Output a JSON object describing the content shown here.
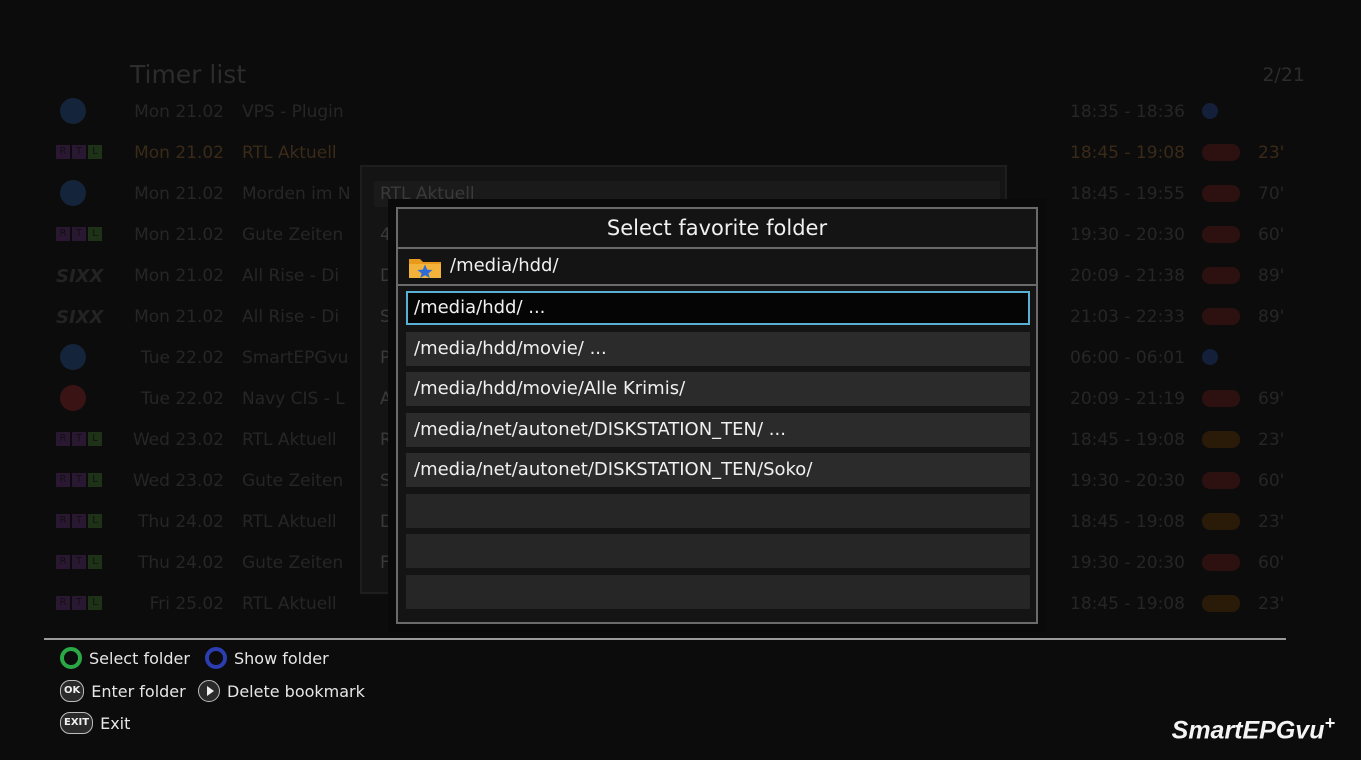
{
  "background": {
    "title": "Timer list",
    "page_indicator": "2/21",
    "timers": [
      {
        "date": "Mon 21.02",
        "name": "VPS - Plugin",
        "time": "18:35 - 18:36",
        "duration": "",
        "status": "blue",
        "logo": "calendar-icon"
      },
      {
        "date": "Mon 21.02",
        "name": "RTL Aktuell",
        "time": "18:45 - 19:08",
        "duration": "23'",
        "status": "red",
        "logo": "rtl-logo"
      },
      {
        "date": "Mon 21.02",
        "name": "Morden im N",
        "time": "18:45 - 19:55",
        "duration": "70'",
        "status": "red",
        "logo": "das-erste-logo"
      },
      {
        "date": "Mon 21.02",
        "name": "Gute Zeiten",
        "time": "19:30 - 20:30",
        "duration": "60'",
        "status": "red",
        "logo": "rtl-logo"
      },
      {
        "date": "Mon 21.02",
        "name": "All Rise - Di",
        "time": "20:09 - 21:38",
        "duration": "89'",
        "status": "red",
        "logo": "sixx-logo"
      },
      {
        "date": "Mon 21.02",
        "name": "All Rise - Di",
        "time": "21:03 - 22:33",
        "duration": "89'",
        "status": "red",
        "logo": "sixx-logo"
      },
      {
        "date": "Tue 22.02",
        "name": "SmartEPGvu",
        "time": "06:00 - 06:01",
        "duration": "",
        "status": "blue",
        "logo": "satellite-icon"
      },
      {
        "date": "Tue 22.02",
        "name": "Navy CIS - L",
        "time": "20:09 - 21:19",
        "duration": "69'",
        "status": "red",
        "logo": "sat1-logo"
      },
      {
        "date": "Wed 23.02",
        "name": "RTL Aktuell",
        "time": "18:45 - 19:08",
        "duration": "23'",
        "status": "rec",
        "logo": "rtl-logo"
      },
      {
        "date": "Wed 23.02",
        "name": "Gute Zeiten",
        "time": "19:30 - 20:30",
        "duration": "60'",
        "status": "red",
        "logo": "rtl-logo"
      },
      {
        "date": "Thu 24.02",
        "name": "RTL Aktuell",
        "time": "18:45 - 19:08",
        "duration": "23'",
        "status": "rec",
        "logo": "rtl-logo"
      },
      {
        "date": "Thu 24.02",
        "name": "Gute Zeiten",
        "time": "19:30 - 20:30",
        "duration": "60'",
        "status": "red",
        "logo": "rtl-logo"
      },
      {
        "date": "Fri 25.02",
        "name": "RTL Aktuell",
        "time": "18:45 - 19:08",
        "duration": "23'",
        "status": "rec",
        "logo": "rtl-logo"
      }
    ],
    "mid_popup": {
      "header": "RTL Aktuell",
      "letters": [
        "4",
        "D",
        "S",
        "P",
        "A",
        "R",
        "S",
        "D",
        "F"
      ]
    }
  },
  "dialog": {
    "title": "Select favorite folder",
    "current_path": "/media/hdd/",
    "folders": [
      "/media/hdd/ ...",
      "/media/hdd/movie/ ...",
      "/media/hdd/movie/Alle Krimis/",
      "/media/net/autonet/DISKSTATION_TEN/ ...",
      "/media/net/autonet/DISKSTATION_TEN/Soko/",
      "",
      "",
      ""
    ],
    "selected_index": 0
  },
  "footer": {
    "select_folder": "Select folder",
    "show_folder": "Show folder",
    "ok_key": "OK",
    "enter_folder": "Enter folder",
    "delete_bookmark": "Delete bookmark",
    "exit_key": "EXIT",
    "exit": "Exit",
    "brand": "SmartEPGvu",
    "brand_sup": "+"
  },
  "colors": {
    "accent_selection": "#5ab0d4",
    "green_button": "#2aa845",
    "blue_button": "#2b3db0"
  }
}
